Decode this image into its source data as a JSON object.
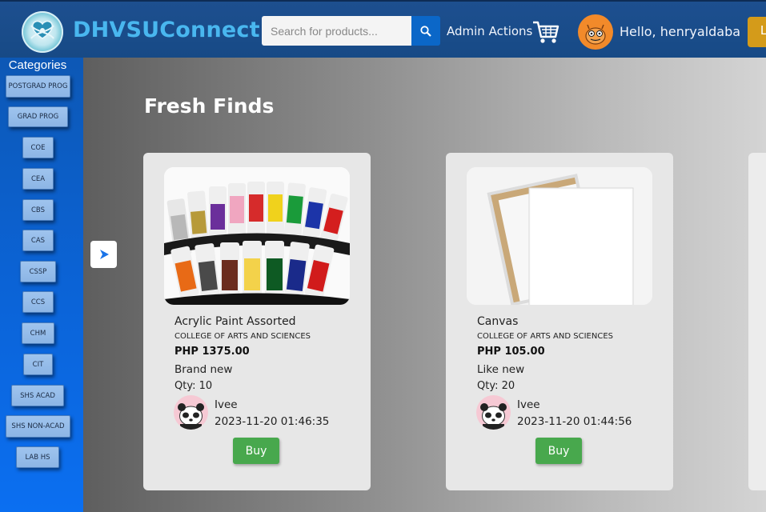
{
  "header": {
    "brand": "DHVSUConnect",
    "search_placeholder": "Search for products...",
    "admin_label": "Admin Actions",
    "greeting": "Hello, henryaldaba",
    "logout_label": "L"
  },
  "sidebar": {
    "title": "Categories",
    "items": [
      {
        "label": "POSTGRAD PROG"
      },
      {
        "label": "GRAD PROG"
      },
      {
        "label": "COE"
      },
      {
        "label": "CEA"
      },
      {
        "label": "CBS"
      },
      {
        "label": "CAS"
      },
      {
        "label": "CSSP"
      },
      {
        "label": "CCS"
      },
      {
        "label": "CHM"
      },
      {
        "label": "CIT"
      },
      {
        "label": "SHS ACAD"
      },
      {
        "label": "SHS NON-ACAD"
      },
      {
        "label": "LAB HS"
      }
    ]
  },
  "main": {
    "section_title": "Fresh Finds",
    "products": [
      {
        "name": "Acrylic Paint Assorted",
        "college": "COLLEGE OF ARTS AND SCIENCES",
        "price": "PHP 1375.00",
        "condition": "Brand new",
        "qty": "Qty: 10",
        "seller": "Ivee",
        "date": "2023-11-20 01:46:35",
        "buy_label": "Buy"
      },
      {
        "name": "Canvas",
        "college": "COLLEGE OF ARTS AND SCIENCES",
        "price": "PHP 105.00",
        "condition": "Like new",
        "qty": "Qty: 20",
        "seller": "Ivee",
        "date": "2023-11-20 01:44:56",
        "buy_label": "Buy"
      }
    ]
  },
  "icons": [
    "logo-icon",
    "search-icon",
    "cart-icon",
    "user-avatar",
    "next-arrow-icon",
    "seller-avatar"
  ],
  "colors": {
    "header_bg": "#174a86",
    "brand": "#49b7ef",
    "sidebar_bg": "#0b63d6",
    "buy_button": "#48a84d",
    "search_button": "#0b67c8",
    "logout_button": "#d49b1a"
  }
}
